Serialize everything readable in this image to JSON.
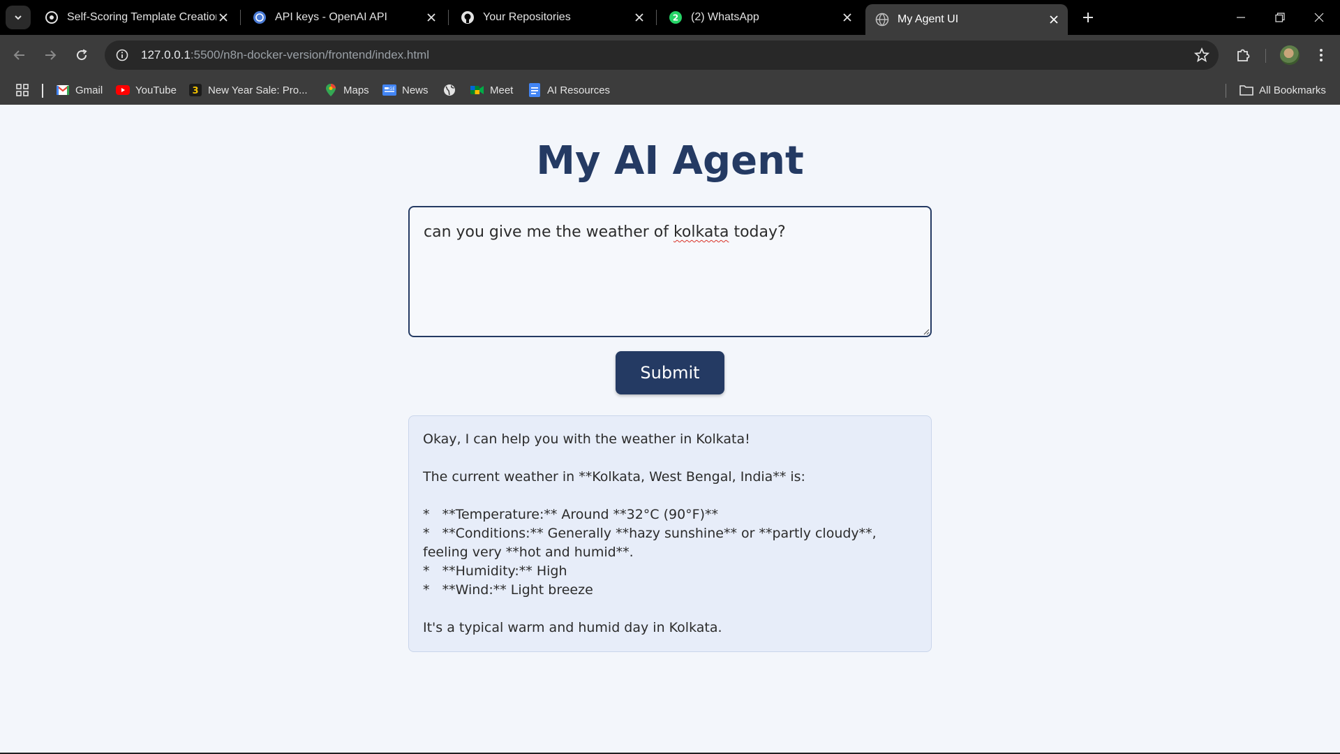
{
  "browser": {
    "tabs": [
      {
        "title": "Self-Scoring Template Creation",
        "icon": "openai-icon"
      },
      {
        "title": "API keys - OpenAI API",
        "icon": "openai-icon"
      },
      {
        "title": "Your Repositories",
        "icon": "github-icon"
      },
      {
        "title": "(2) WhatsApp",
        "icon": "whatsapp-icon",
        "badge": "2"
      },
      {
        "title": "My Agent UI",
        "icon": "globe-icon",
        "active": true
      }
    ],
    "url_host": "127.0.0.1",
    "url_path": ":5500/n8n-docker-version/frontend/index.html",
    "bookmarks": [
      {
        "label": "Gmail",
        "icon": "gmail-icon"
      },
      {
        "label": "YouTube",
        "icon": "youtube-icon"
      },
      {
        "label": "New Year Sale: Pro...",
        "icon": "sale-icon"
      },
      {
        "label": "Maps",
        "icon": "maps-icon"
      },
      {
        "label": "News",
        "icon": "news-icon"
      },
      {
        "label": "",
        "icon": "globe-icon"
      },
      {
        "label": "Meet",
        "icon": "meet-icon"
      },
      {
        "label": "AI Resources",
        "icon": "docs-icon"
      }
    ],
    "all_bookmarks": "All Bookmarks"
  },
  "app": {
    "title": "My AI Agent",
    "prompt_before": "can you give me the weather of ",
    "prompt_misspelled": "kolkata",
    "prompt_after": " today?",
    "submit_label": "Submit",
    "response": "Okay, I can help you with the weather in Kolkata!\n\nThe current weather in **Kolkata, West Bengal, India** is:\n\n*   **Temperature:** Around **32°C (90°F)**\n*   **Conditions:** Generally **hazy sunshine** or **partly cloudy**, feeling very **hot and humid**.\n*   **Humidity:** High\n*   **Wind:** Light breeze\n\nIt's a typical warm and humid day in Kolkata."
  },
  "colors": {
    "accent": "#243a63",
    "response_bg": "#e7edf9",
    "page_bg": "#f3f6fb"
  }
}
